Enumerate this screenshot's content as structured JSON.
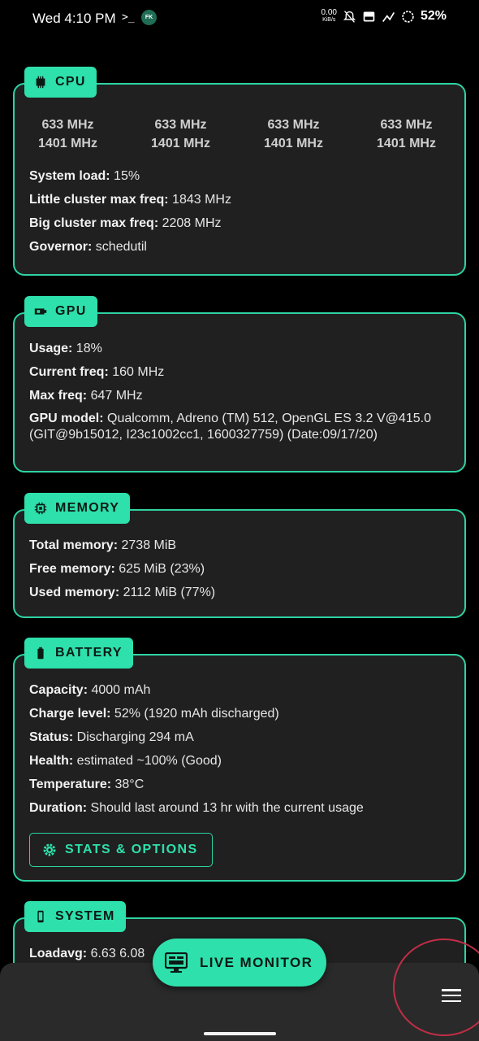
{
  "status_bar": {
    "time": "Wed 4:10 PM",
    "terminal_glyph": ">_",
    "app_badge": "FK",
    "net_speed_value": "0.00",
    "net_speed_unit": "KiB/s",
    "battery_percent": "52%"
  },
  "cpu": {
    "title": "CPU",
    "cores": [
      {
        "cur": "633 MHz",
        "max": "1401 MHz"
      },
      {
        "cur": "633 MHz",
        "max": "1401 MHz"
      },
      {
        "cur": "633 MHz",
        "max": "1401 MHz"
      },
      {
        "cur": "633 MHz",
        "max": "1401 MHz"
      }
    ],
    "rows": [
      {
        "k": "System load:",
        "v": " 15%"
      },
      {
        "k": "Little cluster max freq:",
        "v": " 1843 MHz"
      },
      {
        "k": "Big cluster max freq:",
        "v": " 2208 MHz"
      },
      {
        "k": "Governor:",
        "v": " schedutil"
      }
    ]
  },
  "gpu": {
    "title": "GPU",
    "rows": [
      {
        "k": "Usage:",
        "v": " 18%"
      },
      {
        "k": "Current freq:",
        "v": " 160 MHz"
      },
      {
        "k": "Max freq:",
        "v": " 647 MHz"
      }
    ],
    "model_label": "GPU model:",
    "model_value": " Qualcomm, Adreno (TM) 512, OpenGL ES 3.2 V@415.0 (GIT@9b15012, I23c1002cc1, 1600327759) (Date:09/17/20)"
  },
  "memory": {
    "title": "MEMORY",
    "rows": [
      {
        "k": "Total memory:",
        "v": " 2738 MiB"
      },
      {
        "k": "Free memory:",
        "v": " 625 MiB (23%)"
      },
      {
        "k": "Used memory:",
        "v": " 2112 MiB (77%)"
      }
    ]
  },
  "battery": {
    "title": "BATTERY",
    "rows": [
      {
        "k": "Capacity:",
        "v": " 4000 mAh"
      },
      {
        "k": "Charge level:",
        "v": " 52% (1920 mAh discharged)"
      },
      {
        "k": "Status:",
        "v": " Discharging 294 mA"
      },
      {
        "k": "Health:",
        "v": " estimated ~100% (Good)"
      },
      {
        "k": "Temperature:",
        "v": " 38°C"
      },
      {
        "k": "Duration:",
        "v": " Should last around 13 hr with the current usage"
      }
    ],
    "stats_button": "STATS & OPTIONS"
  },
  "system": {
    "title": "SYSTEM",
    "loadavg_label": "Loadavg:",
    "loadavg_value": " 6.63 6.08"
  },
  "fab": {
    "label": "LIVE MONITOR"
  },
  "colors": {
    "accent": "#2ee0ab",
    "card_bg": "#202020",
    "background": "#000000",
    "bottom_bar": "#2a2a2a",
    "annotation": "#c12e46"
  }
}
